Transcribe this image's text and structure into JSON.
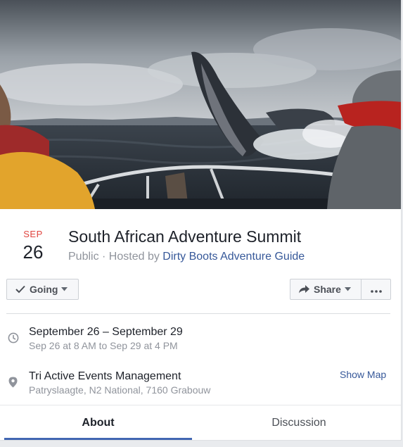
{
  "event": {
    "month": "SEP",
    "day": "26",
    "title": "South African Adventure Summit",
    "privacy": "Public",
    "separator": " · ",
    "hosted_prefix": "Hosted by ",
    "host": "Dirty Boots Adventure Guide"
  },
  "actions": {
    "going_label": "Going",
    "share_label": "Share"
  },
  "time": {
    "range": "September 26 – September 29",
    "detail": "Sep 26 at 8 AM to Sep 29 at 4 PM"
  },
  "location": {
    "name": "Tri Active Events Management",
    "address": "Patryslaagte, N2 National, 7160 Grabouw",
    "map_link": "Show Map"
  },
  "tabs": [
    {
      "label": "About",
      "active": true
    },
    {
      "label": "Discussion",
      "active": false
    }
  ],
  "icons": {
    "going": "check-icon",
    "share": "share-arrow-icon",
    "more": "more-dots-icon",
    "time": "clock-icon",
    "location": "map-pin-icon"
  },
  "colors": {
    "accent": "#4267b2",
    "link": "#365899",
    "month": "#e0443e",
    "muted": "#90949c"
  }
}
